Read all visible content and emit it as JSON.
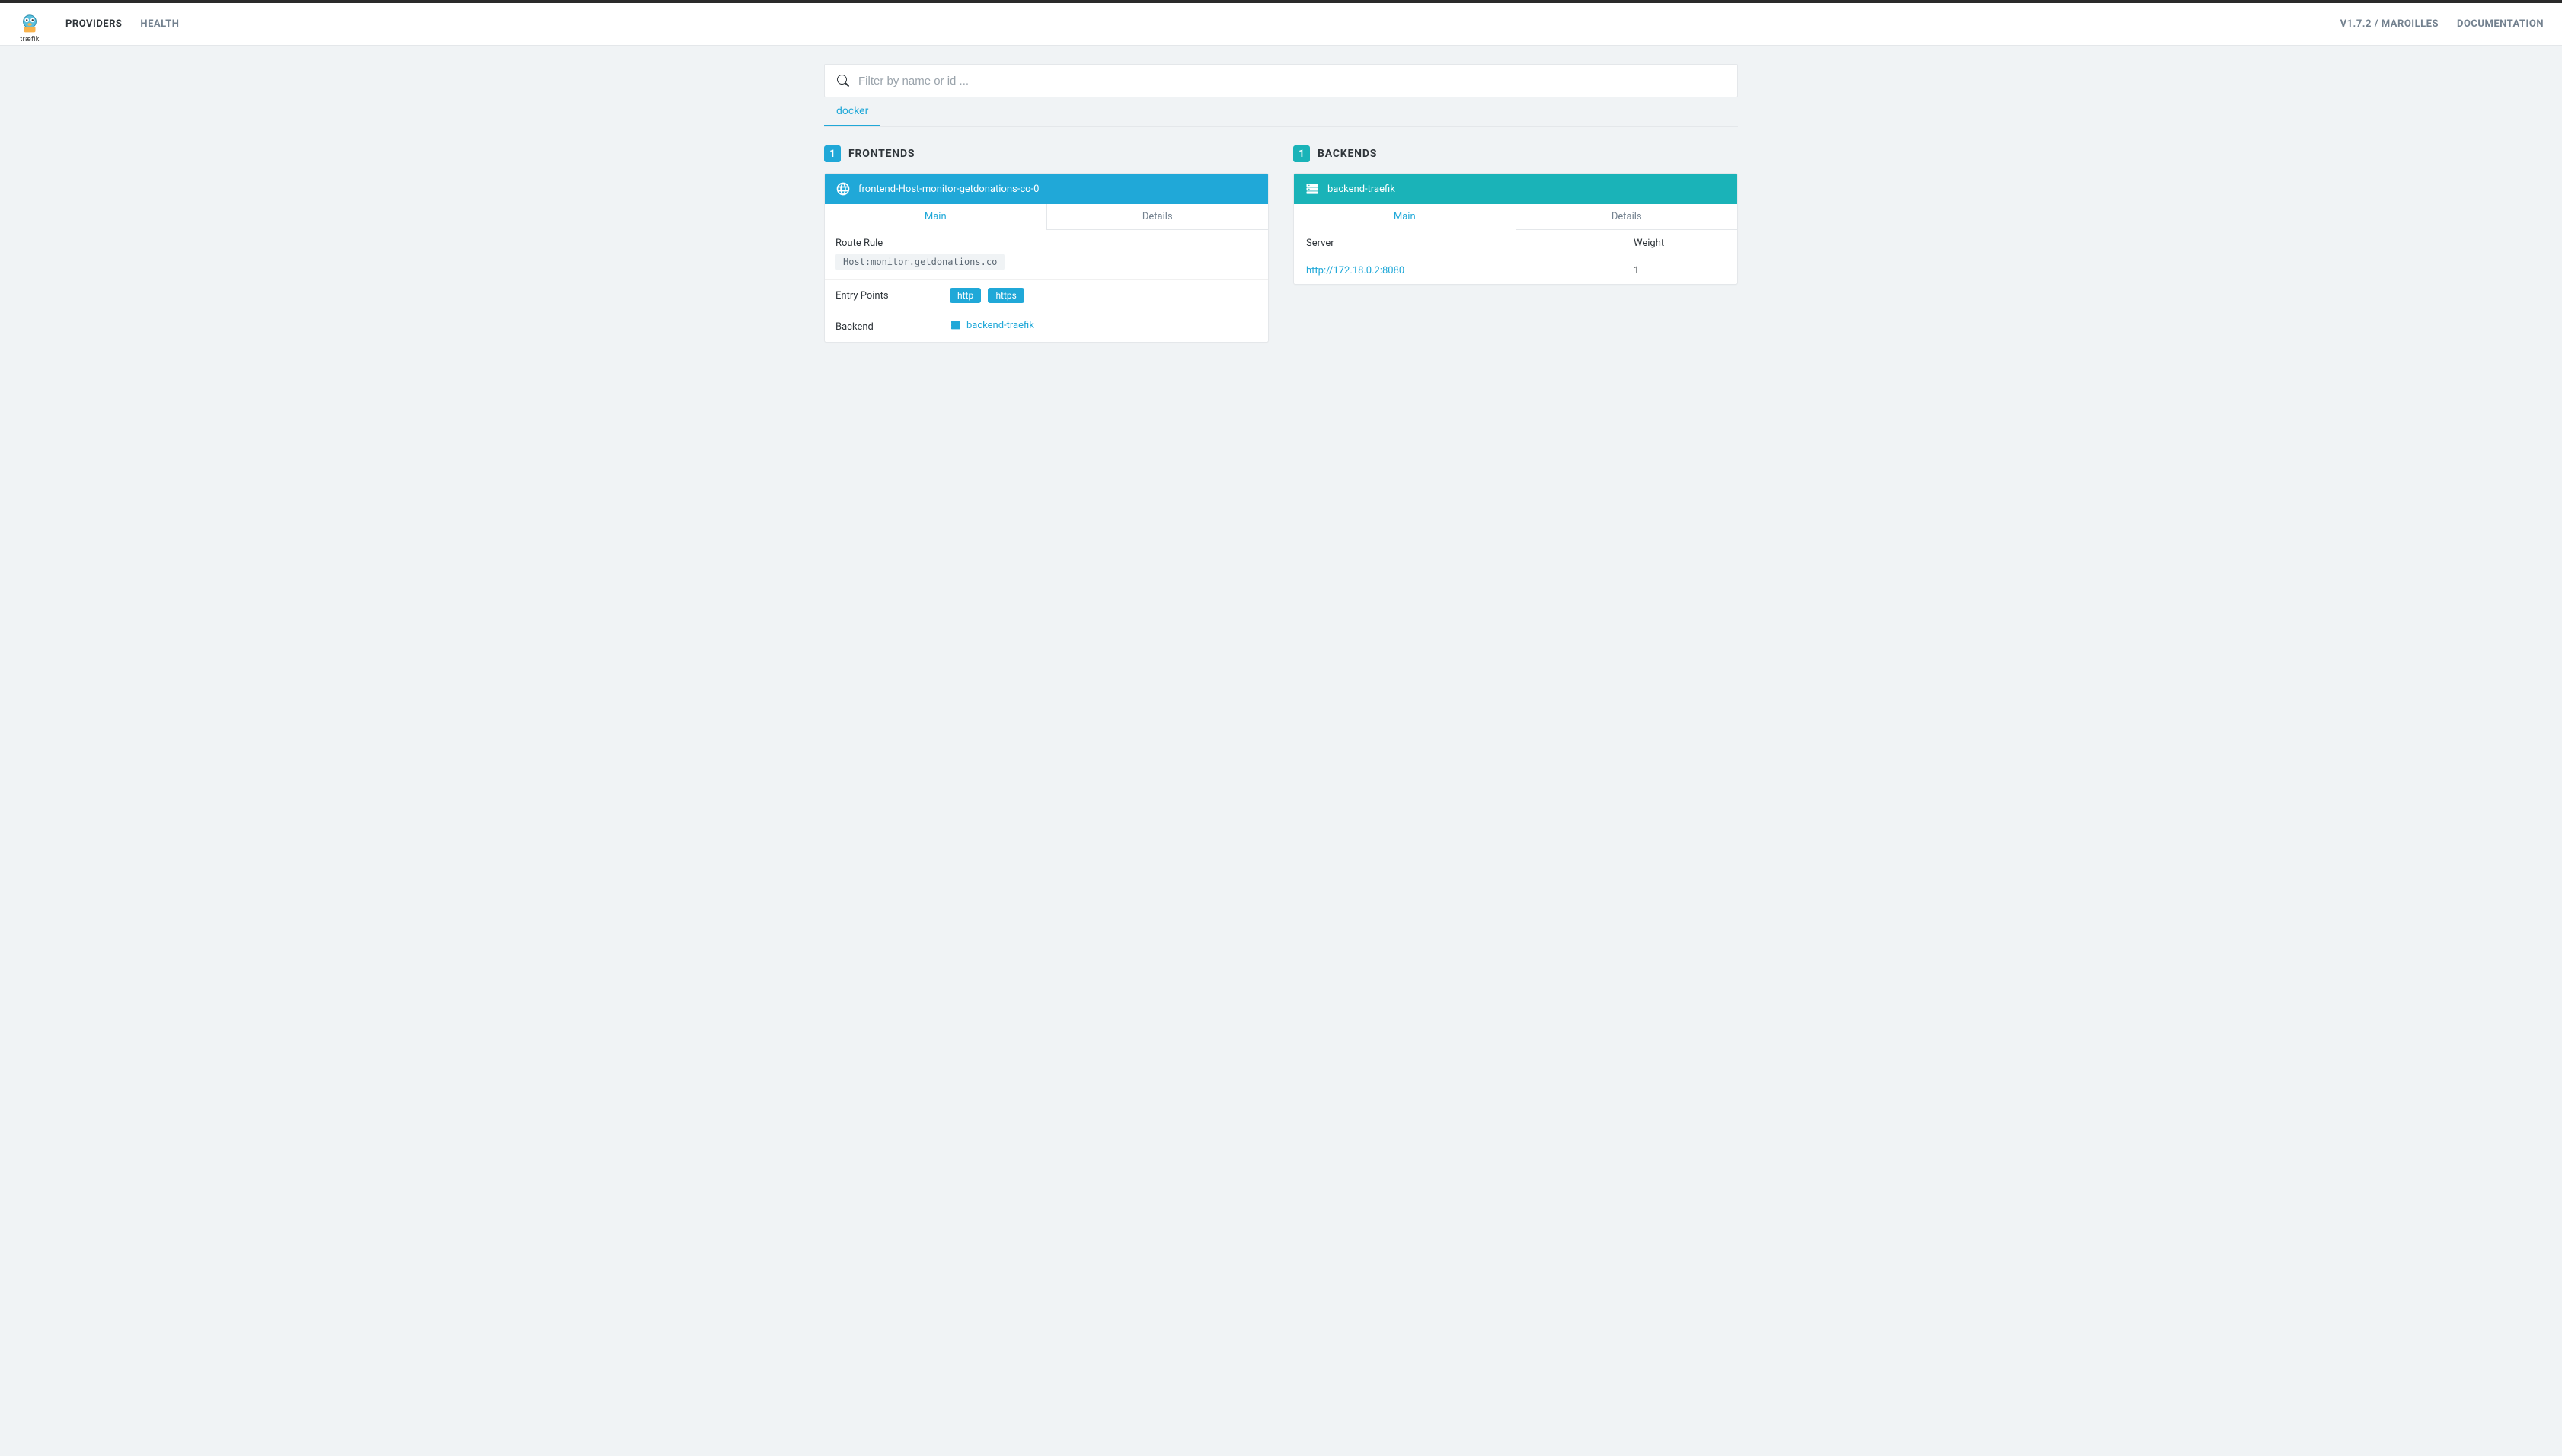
{
  "nav": {
    "providers": "Providers",
    "health": "Health",
    "version": "V1.7.2 / MAROILLES",
    "documentation": "Documentation",
    "logo_text": "træfik"
  },
  "search": {
    "placeholder": "Filter by name or id ..."
  },
  "provider_tabs": [
    {
      "label": "docker",
      "active": true
    }
  ],
  "frontends": {
    "title": "Frontends",
    "count": "1",
    "items": [
      {
        "name": "frontend-Host-monitor-getdonations-co-0",
        "tabs": {
          "main": "Main",
          "details": "Details"
        },
        "route_rule_label": "Route Rule",
        "route_rule": "Host:monitor.getdonations.co",
        "entry_points_label": "Entry Points",
        "entry_points": [
          "http",
          "https"
        ],
        "backend_label": "Backend",
        "backend": "backend-traefik"
      }
    ]
  },
  "backends": {
    "title": "Backends",
    "count": "1",
    "items": [
      {
        "name": "backend-traefik",
        "tabs": {
          "main": "Main",
          "details": "Details"
        },
        "columns": {
          "server": "Server",
          "weight": "Weight"
        },
        "servers": [
          {
            "url": "http://172.18.0.2:8080",
            "weight": "1"
          }
        ]
      }
    ]
  }
}
